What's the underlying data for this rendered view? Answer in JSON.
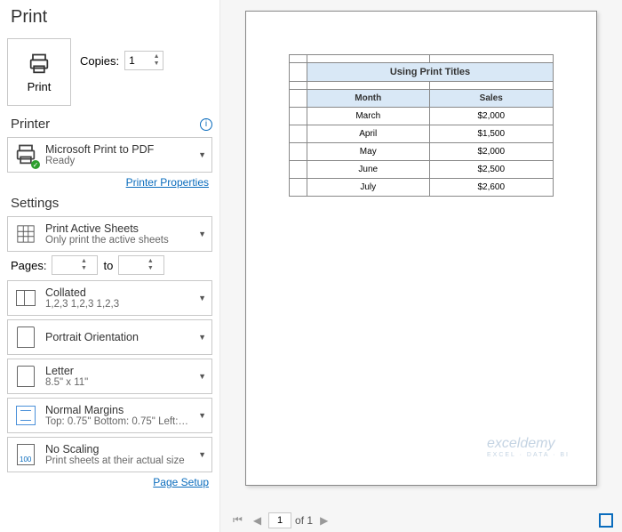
{
  "title": "Print",
  "printButton": "Print",
  "copies": {
    "label": "Copies:",
    "value": "1"
  },
  "printerSection": "Printer",
  "printer": {
    "name": "Microsoft Print to PDF",
    "status": "Ready"
  },
  "printerProperties": "Printer Properties",
  "settingsSection": "Settings",
  "settings": {
    "scope": {
      "title": "Print Active Sheets",
      "sub": "Only print the active sheets"
    },
    "pagesLabel": "Pages:",
    "pagesTo": "to",
    "collate": {
      "title": "Collated",
      "sub": "1,2,3   1,2,3   1,2,3"
    },
    "orientation": {
      "title": "Portrait Orientation",
      "sub": ""
    },
    "paper": {
      "title": "Letter",
      "sub": "8.5\" x 11\""
    },
    "margins": {
      "title": "Normal Margins",
      "sub": "Top: 0.75\" Bottom: 0.75\" Left:…"
    },
    "scaling": {
      "title": "No Scaling",
      "sub": "Print sheets at their actual size",
      "num": "100"
    }
  },
  "pageSetup": "Page Setup",
  "chart_data": {
    "type": "table",
    "title": "Using Print Titles",
    "columns": [
      "Month",
      "Sales"
    ],
    "rows": [
      [
        "March",
        "$2,000"
      ],
      [
        "April",
        "$1,500"
      ],
      [
        "May",
        "$2,000"
      ],
      [
        "June",
        "$2,500"
      ],
      [
        "July",
        "$2,600"
      ]
    ]
  },
  "watermark": {
    "main": "exceldemy",
    "sub": "EXCEL · DATA · BI"
  },
  "pager": {
    "current": "1",
    "total": "of 1"
  }
}
